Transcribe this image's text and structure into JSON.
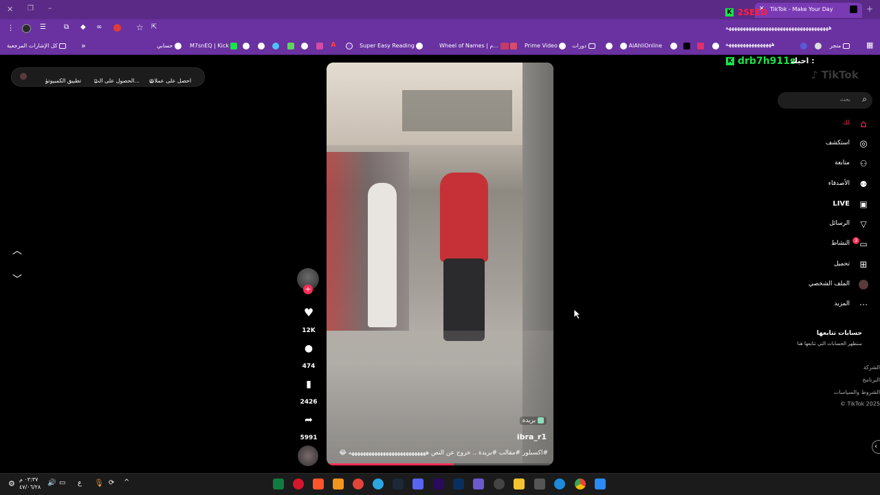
{
  "browser": {
    "tab_title": "TikTok - Make Your Day",
    "overlay_top": "2SEED",
    "overlay_scroll": "ههههههههههههههههههههههههههههههههههههه",
    "overlay_scroll2": "ههههههههههههههههه",
    "overlay_user": "drb7h911s",
    "overlay_love": "احبك :",
    "bookmarks": {
      "all_bookmarks": "كل الإشارات المرجعية",
      "account": "حسابي",
      "kick": "M7snEQ | Kick",
      "super_easy": "Super Easy Reading",
      "wheel": "Wheel of Names | م...",
      "prime": "Prime Video",
      "courses": "دورات",
      "alahli": "AlAhliOnline",
      "store": "متجر"
    }
  },
  "topbar": {
    "get_coins": "احصل على عملات",
    "get_app": "الحصول على الت...",
    "desktop_app": "تطبيق الكمبيوتر"
  },
  "sidebar": {
    "logo": "TikTok",
    "search_placeholder": "بحث",
    "items": [
      {
        "label": "لك",
        "icon": "home-icon"
      },
      {
        "label": "استكشف",
        "icon": "compass-icon"
      },
      {
        "label": "متابعة",
        "icon": "user-follow-icon"
      },
      {
        "label": "الأصدقاء",
        "icon": "friends-icon"
      },
      {
        "label": "LIVE",
        "icon": "live-icon"
      },
      {
        "label": "الرسائل",
        "icon": "send-icon"
      },
      {
        "label": "النشاط",
        "icon": "activity-icon",
        "badge": "3"
      },
      {
        "label": "تحميل",
        "icon": "upload-icon"
      },
      {
        "label": "الملف الشخصي",
        "icon": "profile-avatar-icon"
      },
      {
        "label": "المزيد",
        "icon": "more-icon"
      }
    ],
    "following_title": "حسابات تتابعها",
    "following_hint": "ستظهر الحسابات التي تتابعها هنا",
    "footer": [
      "الشركة",
      "البرنامج",
      "الشروط والسياسات",
      "© TikTok 2025"
    ]
  },
  "video": {
    "location": "بريدة",
    "username": "ibra_r1",
    "caption": "#اكسبلور #مقالب #بريدة .. خروج عن النص هههههههههههههههههههههههههههه 😂",
    "likes": "12K",
    "comments": "474",
    "saves": "2426",
    "shares": "5991",
    "progress": 0.56
  },
  "taskbar": {
    "time": "٠٣:٣٧ م",
    "date": "٤٧/٠٦/٢٨",
    "lang": "ع"
  },
  "colors": {
    "chrome_dark": "#5a2a86",
    "chrome": "#6a31a0",
    "tiktok_red": "#fe2c55",
    "kick_green": "#1be14a"
  }
}
